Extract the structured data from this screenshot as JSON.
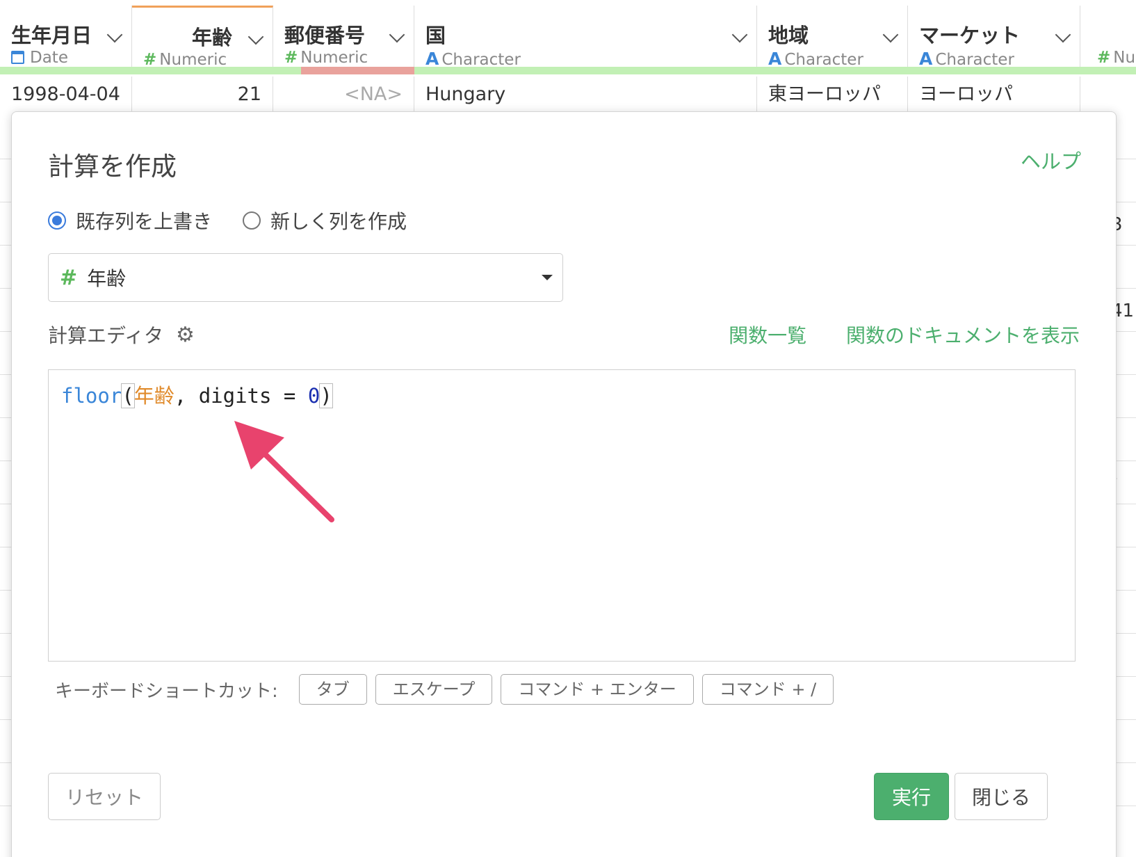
{
  "columns": [
    {
      "name": "生年月日",
      "type_label": "Date",
      "type_icon": "calendar-icon"
    },
    {
      "name": "年齢",
      "type_label": "Numeric",
      "type_icon": "#"
    },
    {
      "name": "郵便番号",
      "type_label": "Numeric",
      "type_icon": "#"
    },
    {
      "name": "国",
      "type_label": "Character",
      "type_icon": "A"
    },
    {
      "name": "地域",
      "type_label": "Character",
      "type_icon": "A"
    },
    {
      "name": "マーケット",
      "type_label": "Character",
      "type_icon": "A"
    },
    {
      "name": "",
      "type_label": "Nu",
      "type_icon": "#"
    }
  ],
  "row": [
    "1998-04-04",
    "21",
    "<NA>",
    "Hungary",
    "東ヨーロッパ",
    "ヨーロッパ"
  ],
  "right_peek": [
    "3",
    "41",
    "-"
  ],
  "dialog": {
    "title": "計算を作成",
    "help": "ヘルプ",
    "radio_overwrite": "既存列を上書き",
    "radio_new": "新しく列を作成",
    "column_select_icon": "#",
    "column_select_value": "年齢",
    "editor_label": "計算エディタ",
    "function_list": "関数一覧",
    "function_docs": "関数のドキュメントを表示",
    "code": {
      "fn": "floor",
      "open": "(",
      "col": "年齢",
      "rest": ", digits = ",
      "num": "0",
      "close": ")"
    },
    "shortcuts_label": "キーボードショートカット:",
    "shortcuts": [
      "タブ",
      "エスケープ",
      "コマンド + エンター",
      "コマンド + /"
    ],
    "reset": "リセット",
    "run": "実行",
    "close": "閉じる"
  },
  "colors": {
    "accent_green": "#4caf6e",
    "radio_blue": "#3a7bdc",
    "arrow_pink": "#e8436d",
    "active_col_orange": "#f0a15a"
  }
}
